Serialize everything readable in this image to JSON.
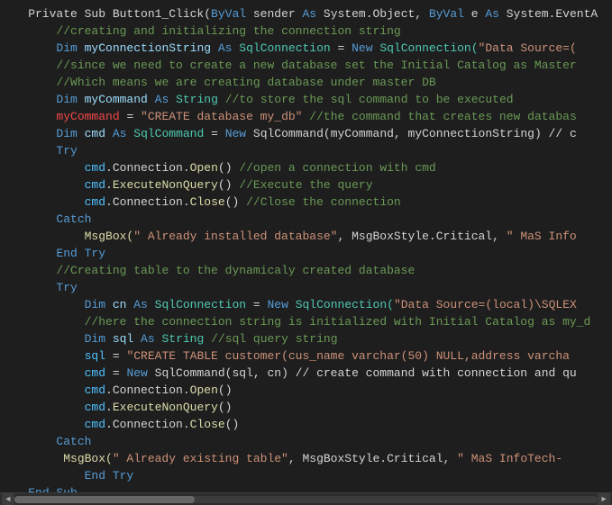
{
  "editor": {
    "background": "#1e1e1e",
    "lines": [
      {
        "id": 1,
        "segments": [
          {
            "text": "    Private Sub Button1_Click(",
            "class": "plain"
          },
          {
            "text": "ByVal",
            "class": "kw"
          },
          {
            "text": " sender ",
            "class": "plain"
          },
          {
            "text": "As",
            "class": "kw"
          },
          {
            "text": " System.Object, ",
            "class": "plain"
          },
          {
            "text": "ByVal",
            "class": "kw"
          },
          {
            "text": " e ",
            "class": "plain"
          },
          {
            "text": "As",
            "class": "kw"
          },
          {
            "text": " System.EventA",
            "class": "plain"
          }
        ]
      },
      {
        "id": 2,
        "segments": [
          {
            "text": "        ",
            "class": "plain"
          },
          {
            "text": "//creating and initializing the connection string",
            "class": "comment"
          }
        ]
      },
      {
        "id": 3,
        "segments": [
          {
            "text": "        ",
            "class": "plain"
          },
          {
            "text": "Dim",
            "class": "kw"
          },
          {
            "text": " myConnectionString ",
            "class": "var"
          },
          {
            "text": "As",
            "class": "kw"
          },
          {
            "text": " ",
            "class": "plain"
          },
          {
            "text": "SqlConnection",
            "class": "type"
          },
          {
            "text": " = ",
            "class": "plain"
          },
          {
            "text": "New",
            "class": "kw"
          },
          {
            "text": " SqlConnection(",
            "class": "type"
          },
          {
            "text": "\"Data Source=(",
            "class": "str"
          }
        ]
      },
      {
        "id": 4,
        "segments": [
          {
            "text": "        ",
            "class": "plain"
          },
          {
            "text": "//since we need to create a new database set the Initial Catalog as Master",
            "class": "comment"
          }
        ]
      },
      {
        "id": 5,
        "segments": [
          {
            "text": "        ",
            "class": "plain"
          },
          {
            "text": "//Which means we are creating database under master DB",
            "class": "comment"
          }
        ]
      },
      {
        "id": 6,
        "segments": [
          {
            "text": "        ",
            "class": "plain"
          },
          {
            "text": "Dim",
            "class": "kw"
          },
          {
            "text": " myCommand ",
            "class": "var"
          },
          {
            "text": "As",
            "class": "kw"
          },
          {
            "text": " ",
            "class": "plain"
          },
          {
            "text": "String",
            "class": "type"
          },
          {
            "text": " ",
            "class": "plain"
          },
          {
            "text": "//to store the sql command to be executed",
            "class": "comment"
          }
        ]
      },
      {
        "id": 7,
        "segments": [
          {
            "text": "        ",
            "class": "plain"
          },
          {
            "text": "myCommand",
            "class": "red"
          },
          {
            "text": " = ",
            "class": "plain"
          },
          {
            "text": "\"CREATE database my_db\"",
            "class": "str"
          },
          {
            "text": " ",
            "class": "plain"
          },
          {
            "text": "//the command that creates new databas",
            "class": "comment"
          }
        ]
      },
      {
        "id": 8,
        "segments": [
          {
            "text": "        ",
            "class": "plain"
          },
          {
            "text": "Dim",
            "class": "kw"
          },
          {
            "text": " cmd ",
            "class": "var"
          },
          {
            "text": "As",
            "class": "kw"
          },
          {
            "text": " ",
            "class": "plain"
          },
          {
            "text": "SqlCommand",
            "class": "type"
          },
          {
            "text": " = ",
            "class": "plain"
          },
          {
            "text": "New",
            "class": "kw"
          },
          {
            "text": " SqlCommand(myCommand, myConnectionString) // c",
            "class": "plain"
          }
        ]
      },
      {
        "id": 9,
        "segments": [
          {
            "text": "        ",
            "class": "plain"
          },
          {
            "text": "Try",
            "class": "kw"
          }
        ]
      },
      {
        "id": 10,
        "segments": [
          {
            "text": "            ",
            "class": "plain"
          },
          {
            "text": "cmd",
            "class": "cyan"
          },
          {
            "text": ".",
            "class": "plain"
          },
          {
            "text": "Connection",
            "class": "plain"
          },
          {
            "text": ".",
            "class": "plain"
          },
          {
            "text": "Open",
            "class": "method"
          },
          {
            "text": "() ",
            "class": "plain"
          },
          {
            "text": "//open a connection with cmd",
            "class": "comment"
          }
        ]
      },
      {
        "id": 11,
        "segments": [
          {
            "text": "            ",
            "class": "plain"
          },
          {
            "text": "cmd",
            "class": "cyan"
          },
          {
            "text": ".",
            "class": "plain"
          },
          {
            "text": "ExecuteNonQuery",
            "class": "method"
          },
          {
            "text": "() ",
            "class": "plain"
          },
          {
            "text": "//Execute the query",
            "class": "comment"
          }
        ]
      },
      {
        "id": 12,
        "segments": [
          {
            "text": "            ",
            "class": "plain"
          },
          {
            "text": "cmd",
            "class": "cyan"
          },
          {
            "text": ".",
            "class": "plain"
          },
          {
            "text": "Connection",
            "class": "plain"
          },
          {
            "text": ".",
            "class": "plain"
          },
          {
            "text": "Close",
            "class": "method"
          },
          {
            "text": "() ",
            "class": "plain"
          },
          {
            "text": "//Close the connection",
            "class": "comment"
          }
        ]
      },
      {
        "id": 13,
        "segments": [
          {
            "text": "        ",
            "class": "plain"
          },
          {
            "text": "Catch",
            "class": "kw"
          }
        ]
      },
      {
        "id": 14,
        "segments": [
          {
            "text": "            ",
            "class": "plain"
          },
          {
            "text": "MsgBox(",
            "class": "method"
          },
          {
            "text": "\" Already installed database\"",
            "class": "str"
          },
          {
            "text": ", MsgBoxStyle.Critical, ",
            "class": "plain"
          },
          {
            "text": "\" MaS Info",
            "class": "str"
          }
        ]
      },
      {
        "id": 15,
        "segments": [
          {
            "text": "        ",
            "class": "plain"
          },
          {
            "text": "End Try",
            "class": "kw"
          }
        ]
      },
      {
        "id": 16,
        "segments": [
          {
            "text": "        ",
            "class": "plain"
          },
          {
            "text": "//Creating table to the dynamicaly created database",
            "class": "comment"
          }
        ]
      },
      {
        "id": 17,
        "segments": [
          {
            "text": "        ",
            "class": "plain"
          },
          {
            "text": "Try",
            "class": "kw"
          }
        ]
      },
      {
        "id": 18,
        "segments": [
          {
            "text": "            ",
            "class": "plain"
          },
          {
            "text": "Dim",
            "class": "kw"
          },
          {
            "text": " cn ",
            "class": "var"
          },
          {
            "text": "As",
            "class": "kw"
          },
          {
            "text": " ",
            "class": "plain"
          },
          {
            "text": "SqlConnection",
            "class": "type"
          },
          {
            "text": " = ",
            "class": "plain"
          },
          {
            "text": "New",
            "class": "kw"
          },
          {
            "text": " SqlConnection(",
            "class": "type"
          },
          {
            "text": "\"Data Source=(local)\\SQLEX",
            "class": "str"
          }
        ]
      },
      {
        "id": 19,
        "segments": [
          {
            "text": "            ",
            "class": "plain"
          },
          {
            "text": "//here the connection string is initialized with Initial Catalog as my_d",
            "class": "comment"
          }
        ]
      },
      {
        "id": 20,
        "segments": [
          {
            "text": "            ",
            "class": "plain"
          },
          {
            "text": "Dim",
            "class": "kw"
          },
          {
            "text": " sql ",
            "class": "var"
          },
          {
            "text": "As",
            "class": "kw"
          },
          {
            "text": " ",
            "class": "plain"
          },
          {
            "text": "String",
            "class": "type"
          },
          {
            "text": " ",
            "class": "plain"
          },
          {
            "text": "//sql query string",
            "class": "comment"
          }
        ]
      },
      {
        "id": 21,
        "segments": [
          {
            "text": "            ",
            "class": "plain"
          },
          {
            "text": "sql",
            "class": "cyan"
          },
          {
            "text": " = ",
            "class": "plain"
          },
          {
            "text": "\"CREATE TABLE customer(cus_name varchar(50) NULL,address varcha",
            "class": "str"
          }
        ]
      },
      {
        "id": 22,
        "segments": [
          {
            "text": "            ",
            "class": "plain"
          },
          {
            "text": "cmd",
            "class": "cyan"
          },
          {
            "text": " = ",
            "class": "plain"
          },
          {
            "text": "New",
            "class": "kw"
          },
          {
            "text": " SqlCommand(sql, cn) // create command with connection and qu",
            "class": "plain"
          }
        ]
      },
      {
        "id": 23,
        "segments": [
          {
            "text": "            ",
            "class": "plain"
          },
          {
            "text": "cmd",
            "class": "cyan"
          },
          {
            "text": ".",
            "class": "plain"
          },
          {
            "text": "Connection",
            "class": "plain"
          },
          {
            "text": ".",
            "class": "plain"
          },
          {
            "text": "Open",
            "class": "method"
          },
          {
            "text": "()",
            "class": "plain"
          }
        ]
      },
      {
        "id": 24,
        "segments": [
          {
            "text": "            ",
            "class": "plain"
          },
          {
            "text": "cmd",
            "class": "cyan"
          },
          {
            "text": ".",
            "class": "plain"
          },
          {
            "text": "ExecuteNonQuery",
            "class": "method"
          },
          {
            "text": "()",
            "class": "plain"
          }
        ]
      },
      {
        "id": 25,
        "segments": [
          {
            "text": "            ",
            "class": "plain"
          },
          {
            "text": "cmd",
            "class": "cyan"
          },
          {
            "text": ".",
            "class": "plain"
          },
          {
            "text": "Connection",
            "class": "plain"
          },
          {
            "text": ".",
            "class": "plain"
          },
          {
            "text": "Close",
            "class": "method"
          },
          {
            "text": "()",
            "class": "plain"
          }
        ]
      },
      {
        "id": 26,
        "segments": [
          {
            "text": "        ",
            "class": "plain"
          },
          {
            "text": "Catch",
            "class": "kw"
          }
        ]
      },
      {
        "id": 27,
        "segments": [
          {
            "text": "         ",
            "class": "plain"
          },
          {
            "text": "MsgBox(",
            "class": "method"
          },
          {
            "text": "\" Already existing table\"",
            "class": "str"
          },
          {
            "text": ", MsgBoxStyle.Critical, ",
            "class": "plain"
          },
          {
            "text": "\" MaS InfoTech-",
            "class": "str"
          }
        ]
      },
      {
        "id": 28,
        "segments": [
          {
            "text": "            ",
            "class": "plain"
          },
          {
            "text": "End Try",
            "class": "kw"
          }
        ]
      },
      {
        "id": 29,
        "segments": [
          {
            "text": "    ",
            "class": "plain"
          },
          {
            "text": "End Sub",
            "class": "kw"
          }
        ]
      }
    ],
    "scrollbar": {
      "left_arrow": "◄",
      "right_arrow": "►"
    }
  }
}
